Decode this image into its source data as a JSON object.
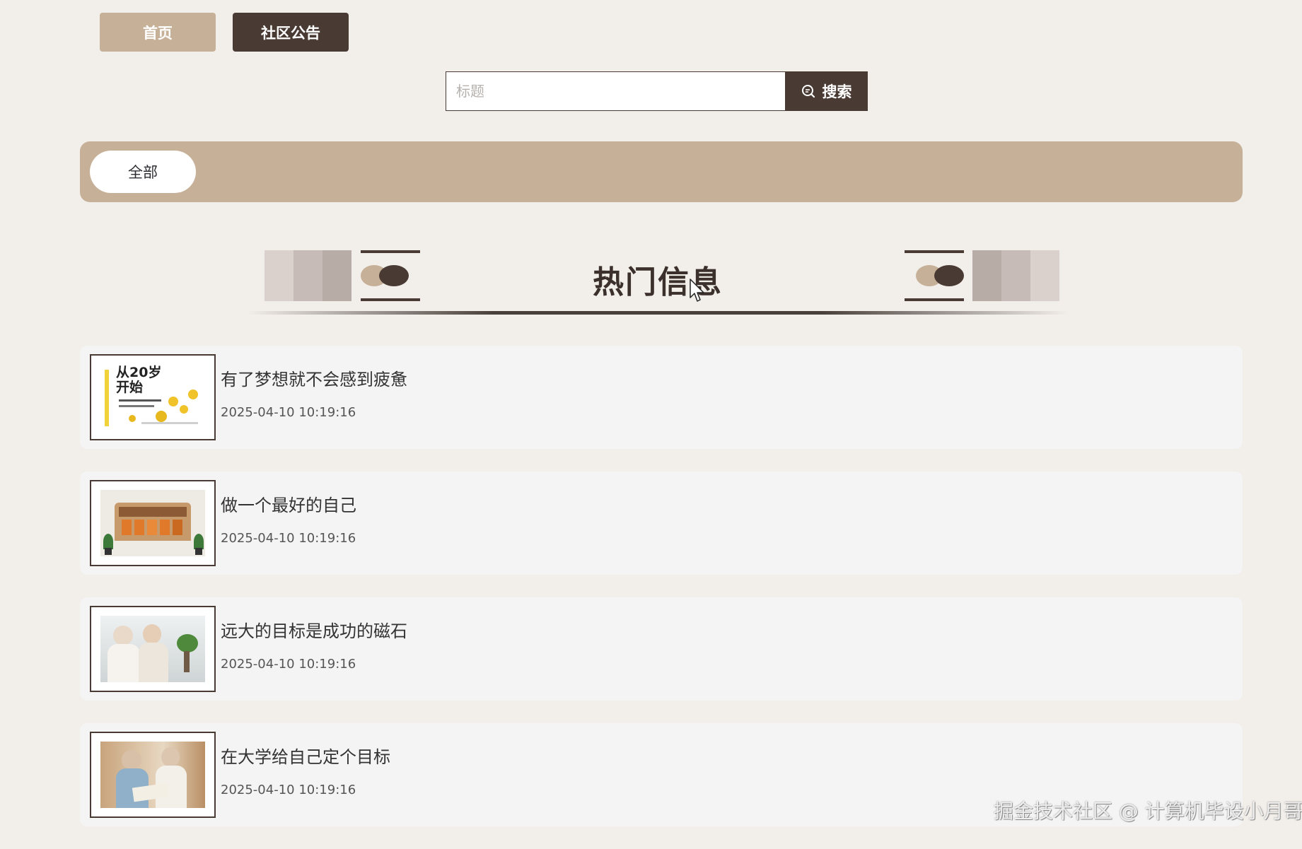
{
  "nav": {
    "home_label": "首页",
    "notice_label": "社区公告"
  },
  "search": {
    "placeholder": "标题",
    "button_label": "搜索",
    "icon": "search-icon"
  },
  "categories": [
    {
      "label": "全部",
      "selected": true
    }
  ],
  "section": {
    "title": "热门信息"
  },
  "posts": [
    {
      "title": "有了梦想就不会感到疲惫",
      "time": "2025-04-10 10:19:16",
      "thumb_text": "从20岁 开始"
    },
    {
      "title": "做一个最好的自己",
      "time": "2025-04-10 10:19:16"
    },
    {
      "title": "远大的目标是成功的磁石",
      "time": "2025-04-10 10:19:16"
    },
    {
      "title": "在大学给自己定个目标",
      "time": "2025-04-10 10:19:16"
    }
  ],
  "watermark": "掘金技术社区 @ 计算机毕设小月哥",
  "colors": {
    "accent_tan": "#c6b198",
    "accent_dark": "#4a3a34",
    "background": "#f2eeea"
  }
}
